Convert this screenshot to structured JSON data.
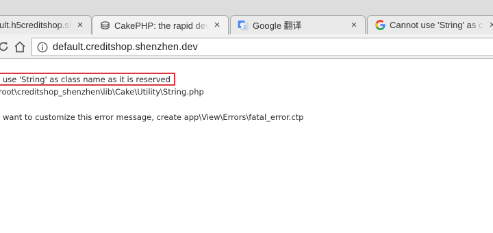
{
  "tabs": [
    {
      "title": "ult.h5creditshop.sh",
      "close": "×",
      "icon": "none",
      "active": false
    },
    {
      "title": "CakePHP: the rapid dev",
      "close": "×",
      "icon": "cakephp-icon",
      "active": true
    },
    {
      "title": "Google 翻译",
      "close": "×",
      "icon": "google-translate-icon",
      "active": false
    },
    {
      "title": "Cannot use 'String' as c",
      "close": "×",
      "icon": "google-icon",
      "active": false
    }
  ],
  "toolbar": {
    "url": "default.creditshop.shenzhen.dev",
    "reload_icon": "reload-icon",
    "home_icon": "home-icon",
    "info_icon": "info-icon"
  },
  "page": {
    "error_title": "use 'String' as class name as it is reserved",
    "error_file": "root\\creditshop_shenzhen\\lib\\Cake\\Utility\\String.php",
    "error_hint": "want to customize this error message, create app\\View\\Errors\\fatal_error.ctp"
  },
  "colors": {
    "highlight_border": "#d9363e",
    "google_blue": "#4285f4",
    "google_red": "#ea4335",
    "google_yellow": "#fbbc05",
    "google_green": "#34a853",
    "translate_blue": "#4a8af4"
  }
}
